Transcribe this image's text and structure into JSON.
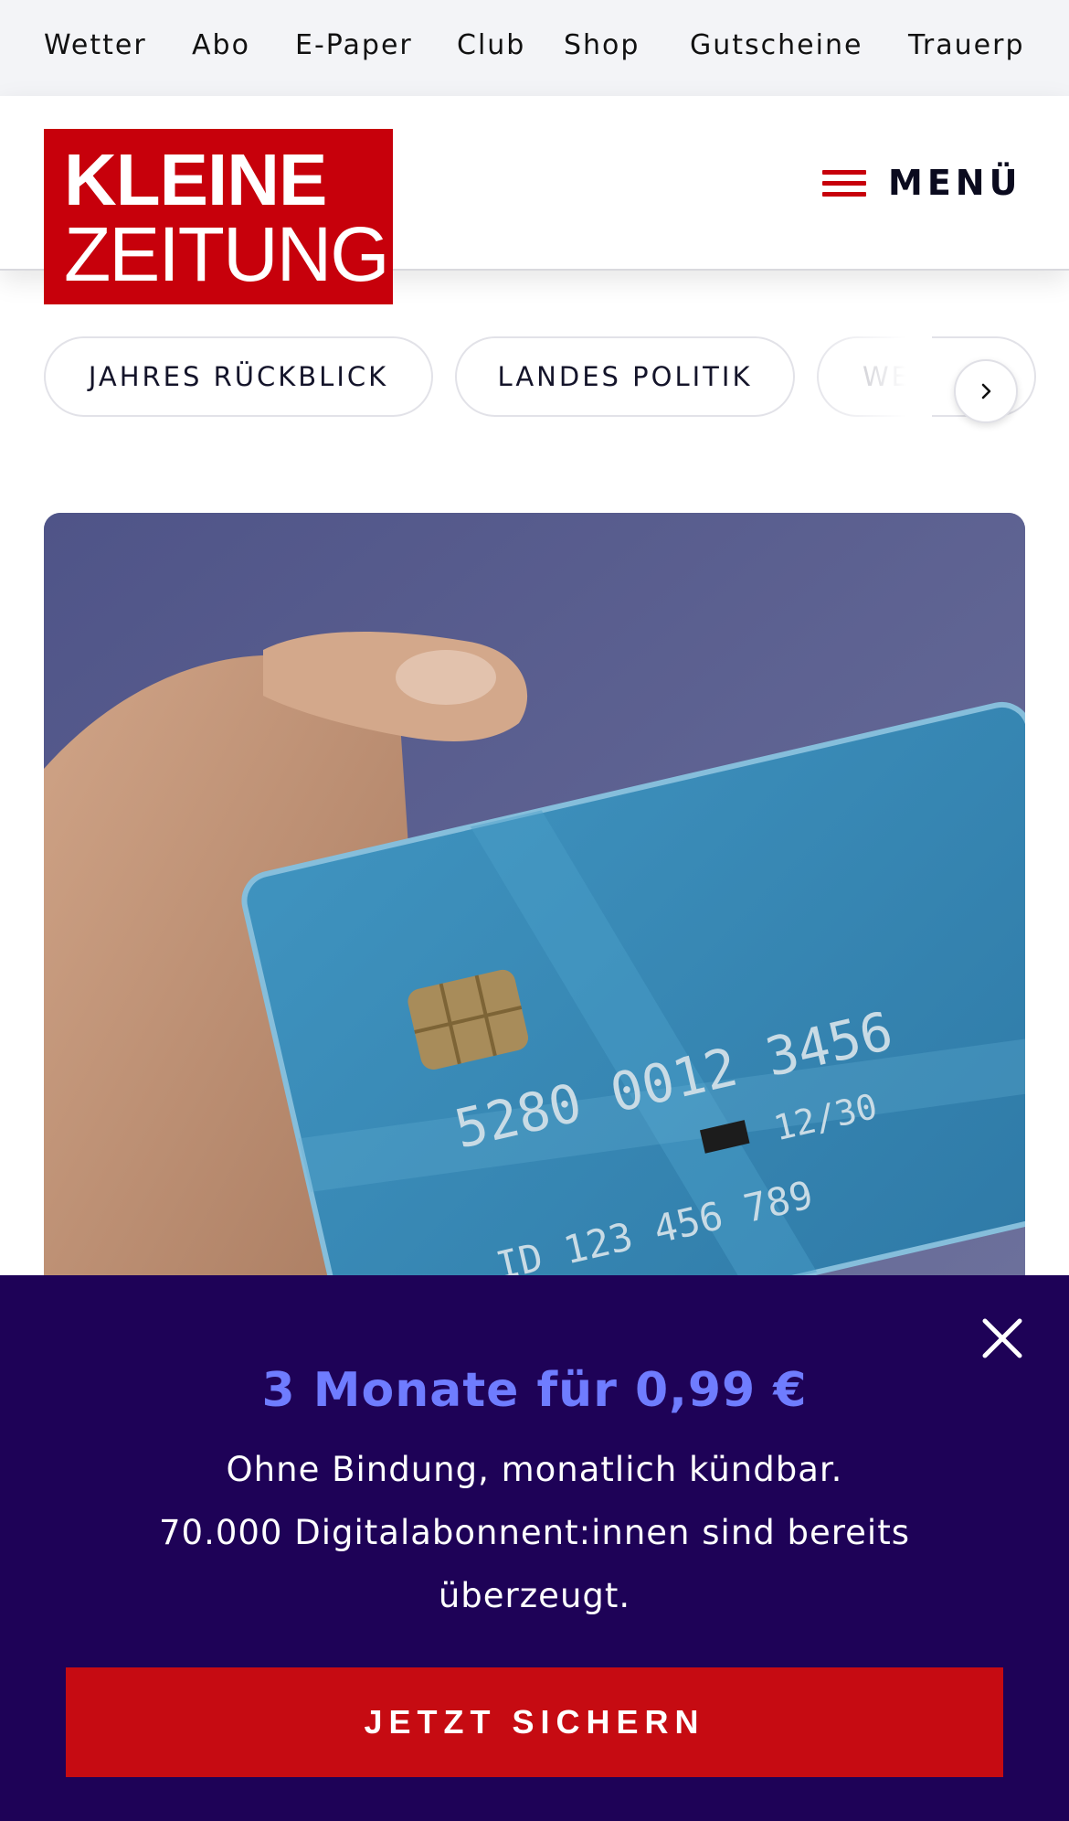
{
  "topnav": {
    "items": [
      "Wetter",
      "Abo",
      "E-Paper",
      "Club",
      "Shop",
      "Gutscheine",
      "Trauerp"
    ]
  },
  "header": {
    "logo_line1": "KLEINE",
    "logo_line2": "ZEITUNG",
    "menu_label": "MENÜ"
  },
  "tags": [
    "JAHRES RÜCKBLICK",
    "LANDES POLITIK",
    "WE"
  ],
  "hero": {
    "card_number": "5280 0012 3456",
    "card_expiry": "12/30",
    "card_id": "ID 123 456 789"
  },
  "banner": {
    "offer": "3 Monate für 0,99 €",
    "line1": "Ohne Bindung, monatlich kündbar.",
    "line2": "70.000 Digitalabonnent:innen sind bereits",
    "line3": "überzeugt.",
    "cta": "JETZT SICHERN"
  },
  "colors": {
    "brand_red": "#c7000b",
    "banner_bg": "#1e0257",
    "offer_blue": "#6f7cff"
  }
}
